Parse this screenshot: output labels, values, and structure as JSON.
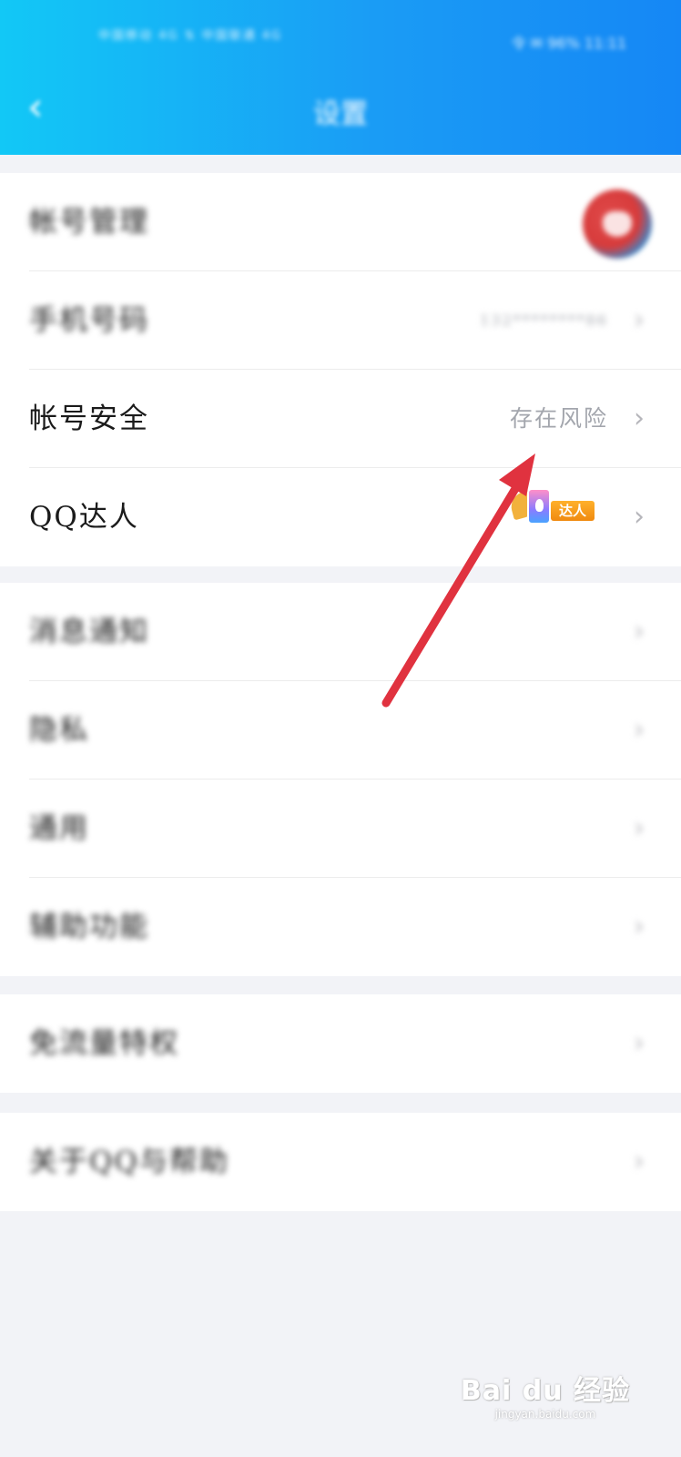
{
  "status_bar": {
    "left_text": "中国移动 4G ⇅ 中国联通 4G",
    "right_text": "令 ✉ 96% 11:11"
  },
  "header": {
    "back_icon": "chevron-left-icon",
    "title": "设置"
  },
  "account_group": [
    {
      "label": "帐号管理",
      "value": "",
      "accessory": "avatar"
    },
    {
      "label": "手机号码",
      "value": "132********86",
      "accessory": "chevron-right-icon"
    },
    {
      "label": "帐号安全",
      "value": "存在风险",
      "accessory": "chevron-right-icon"
    },
    {
      "label": "QQ达人",
      "value": "",
      "badge_text": "达人",
      "accessory": "chevron-right-icon"
    }
  ],
  "settings_group": [
    {
      "label": "消息通知"
    },
    {
      "label": "隐私"
    },
    {
      "label": "通用"
    },
    {
      "label": "辅助功能"
    }
  ],
  "traffic_group": [
    {
      "label": "免流量特权"
    }
  ],
  "about_group": [
    {
      "label": "关于QQ与帮助"
    }
  ],
  "chevron_glyph": "›",
  "back_glyph": "‹",
  "annotation": {
    "color": "#e0323f",
    "target": "帐号安全"
  },
  "watermark": {
    "main": "Bai du 经验",
    "sub": "jingyan.baidu.com"
  }
}
